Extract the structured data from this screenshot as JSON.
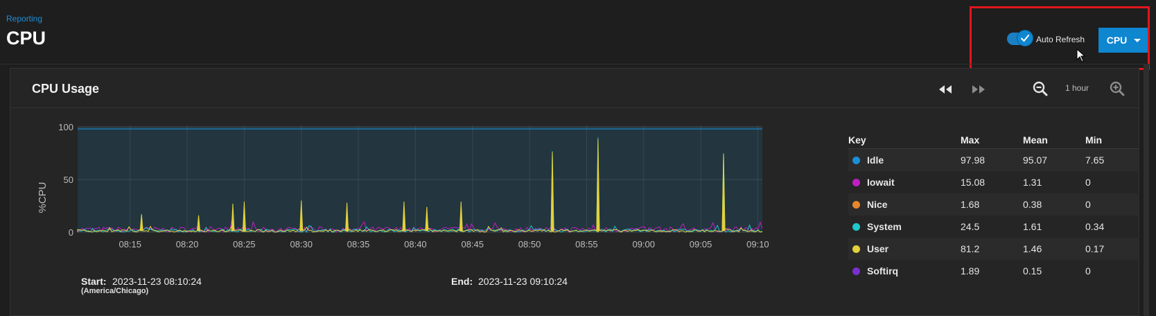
{
  "header": {
    "breadcrumb": "Reporting",
    "title": "CPU",
    "auto_refresh_label": "Auto Refresh",
    "auto_refresh_on": true,
    "report_select_label": "CPU"
  },
  "card": {
    "title": "CPU Usage",
    "zoom_label": "1 hour",
    "start_label": "Start:",
    "start_value": "2023-11-23 08:10:24",
    "timezone": "(America/Chicago)",
    "end_label": "End:",
    "end_value": "2023-11-23 09:10:24"
  },
  "legend": {
    "headers": [
      "Key",
      "Max",
      "Mean",
      "Min"
    ],
    "rows": [
      {
        "name": "Idle",
        "color": "#1a8fd8",
        "max": "97.98",
        "mean": "95.07",
        "min": "7.65"
      },
      {
        "name": "Iowait",
        "color": "#c21ec4",
        "max": "15.08",
        "mean": "1.31",
        "min": "0"
      },
      {
        "name": "Nice",
        "color": "#e8862c",
        "max": "1.68",
        "mean": "0.38",
        "min": "0"
      },
      {
        "name": "System",
        "color": "#1fc7c9",
        "max": "24.5",
        "mean": "1.61",
        "min": "0.34"
      },
      {
        "name": "User",
        "color": "#e2d13a",
        "max": "81.2",
        "mean": "1.46",
        "min": "0.17"
      },
      {
        "name": "Softirq",
        "color": "#7a2fd0",
        "max": "1.89",
        "mean": "0.15",
        "min": "0"
      }
    ]
  },
  "chart_data": {
    "type": "area",
    "title": "",
    "xlabel": "",
    "ylabel": "%CPU",
    "ylim": [
      0,
      100
    ],
    "yticks": [
      0,
      50,
      100
    ],
    "xticks": [
      "08:15",
      "08:20",
      "08:25",
      "08:30",
      "08:35",
      "08:40",
      "08:45",
      "08:50",
      "08:55",
      "09:00",
      "09:05",
      "09:10"
    ],
    "x_range_minutes": [
      "08:10:24",
      "09:10:24"
    ],
    "grid": true,
    "series": [
      {
        "name": "Idle",
        "color": "#1a8fd8",
        "baseline": 98
      },
      {
        "name": "User",
        "color": "#e2d13a",
        "spikes": [
          {
            "t": "08:16",
            "v": 17
          },
          {
            "t": "08:21",
            "v": 16
          },
          {
            "t": "08:24",
            "v": 27
          },
          {
            "t": "08:25",
            "v": 29
          },
          {
            "t": "08:30",
            "v": 30
          },
          {
            "t": "08:34",
            "v": 28
          },
          {
            "t": "08:39",
            "v": 29
          },
          {
            "t": "08:41",
            "v": 24
          },
          {
            "t": "08:44",
            "v": 29
          },
          {
            "t": "08:52",
            "v": 76
          },
          {
            "t": "08:56",
            "v": 88
          },
          {
            "t": "09:07",
            "v": 74
          }
        ]
      },
      {
        "name": "System",
        "color": "#1fc7c9",
        "spikes": [
          {
            "t": "08:52",
            "v": 77
          },
          {
            "t": "08:56",
            "v": 90
          },
          {
            "t": "09:07",
            "v": 75
          }
        ]
      },
      {
        "name": "Iowait",
        "color": "#c21ec4",
        "max": 15.08
      },
      {
        "name": "Nice",
        "color": "#e8862c",
        "max": 1.68
      },
      {
        "name": "Softirq",
        "color": "#7a2fd0",
        "max": 1.89
      }
    ]
  }
}
